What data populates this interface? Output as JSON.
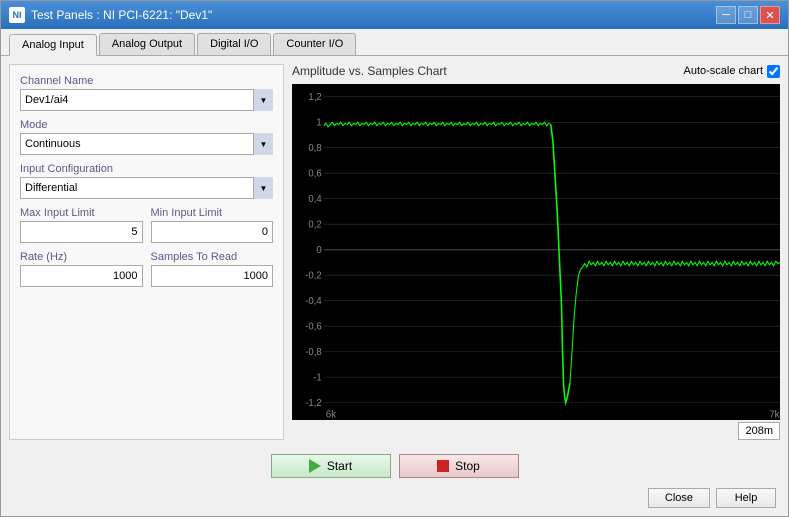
{
  "window": {
    "title": "Test Panels : NI PCI-6221: \"Dev1\"",
    "icon": "NI"
  },
  "tabs": [
    {
      "label": "Analog Input",
      "active": true
    },
    {
      "label": "Analog Output",
      "active": false
    },
    {
      "label": "Digital I/O",
      "active": false
    },
    {
      "label": "Counter I/O",
      "active": false
    }
  ],
  "left_panel": {
    "channel_name_label": "Channel Name",
    "channel_name_value": "Dev1/ai4",
    "mode_label": "Mode",
    "mode_value": "Continuous",
    "input_config_label": "Input Configuration",
    "input_config_value": "Differential",
    "max_input_label": "Max Input Limit",
    "max_input_value": "5",
    "min_input_label": "Min Input Limit",
    "min_input_value": "0",
    "rate_label": "Rate (Hz)",
    "rate_value": "1000",
    "samples_label": "Samples To Read",
    "samples_value": "1000"
  },
  "chart": {
    "title": "Amplitude vs. Samples Chart",
    "autoscale_label": "Auto-scale chart",
    "autoscale_checked": true,
    "y_labels": [
      "1,2",
      "1",
      "0,8",
      "0,6",
      "0,4",
      "0,2",
      "0",
      "-0,2",
      "-0,4",
      "-0,6",
      "-0,8",
      "-1",
      "-1,2"
    ],
    "x_start": "6k",
    "x_end": "7k",
    "timestamp": "208m"
  },
  "buttons": {
    "start_label": "Start",
    "stop_label": "Stop",
    "close_label": "Close",
    "help_label": "Help"
  },
  "colors": {
    "signal": "#00ff00",
    "chart_bg": "#000000",
    "accent": "#4a90d9"
  }
}
